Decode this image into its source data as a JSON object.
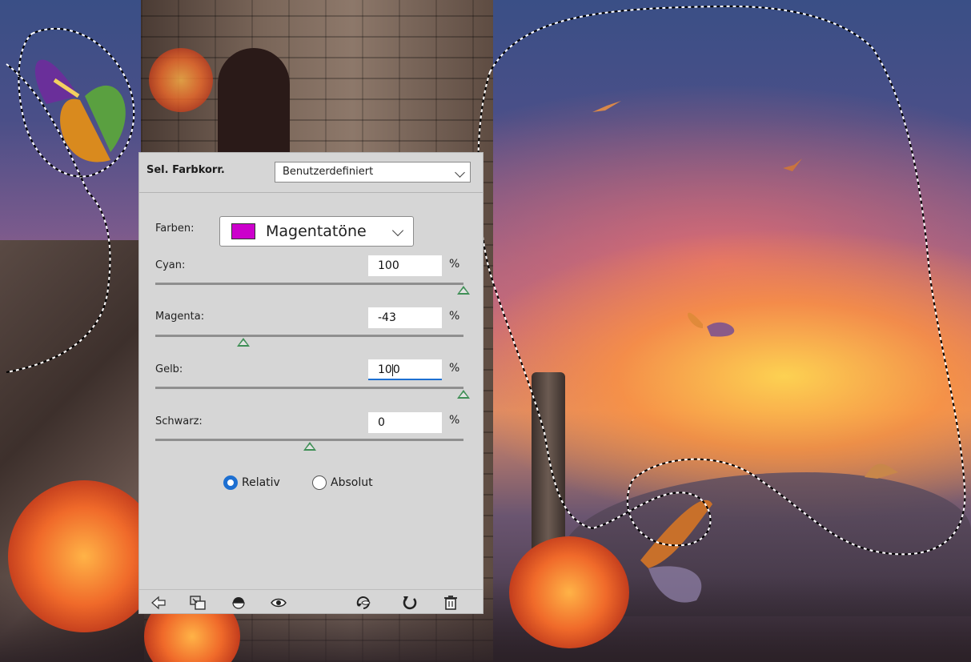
{
  "panel": {
    "title": "Sel. Farbkorr.",
    "preset": "Benutzerdefiniert",
    "colors_label": "Farben:",
    "colors_value": "Magentatöne",
    "colors_swatch": "#cc00cc",
    "sliders": [
      {
        "label": "Cyan:",
        "value": "100",
        "unit": "%",
        "level": 100
      },
      {
        "label": "Magenta:",
        "value": "-43",
        "unit": "%",
        "level": -43
      },
      {
        "label": "Gelb:",
        "value": "100",
        "unit": "%",
        "level": 100
      },
      {
        "label": "Schwarz:",
        "value": "0",
        "unit": "%",
        "level": 0
      }
    ],
    "method": {
      "relative": "Relativ",
      "absolute": "Absolut",
      "selected": "relative"
    },
    "bottom_icons": [
      "back-arrow-icon",
      "clip-to-layer-icon",
      "visibility-previous-icon",
      "eye-icon",
      "reset-view-icon",
      "undo-reset-icon",
      "trash-icon"
    ]
  },
  "colors": {
    "accent": "#1d6fd1",
    "thumb": "#3f8f56",
    "panel_bg": "#d6d6d6"
  }
}
